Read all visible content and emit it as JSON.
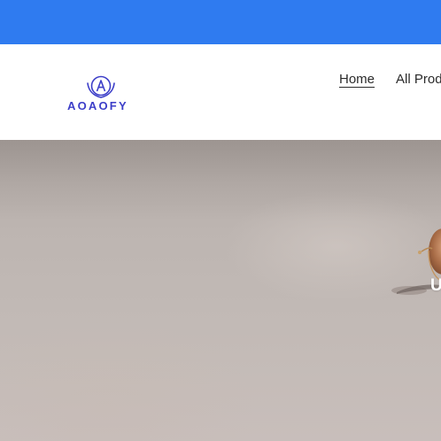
{
  "logo": {
    "text": "AOAOFY",
    "icon": "logo-emblem-icon",
    "color": "#3c3ec8"
  },
  "announcement": {
    "color": "#2f7bf0"
  },
  "nav": {
    "items": [
      {
        "label": "Home",
        "active": true
      },
      {
        "label": "All Prod"
      }
    ]
  },
  "hero": {
    "heading": "U",
    "image": "sunglasses-on-sand"
  }
}
